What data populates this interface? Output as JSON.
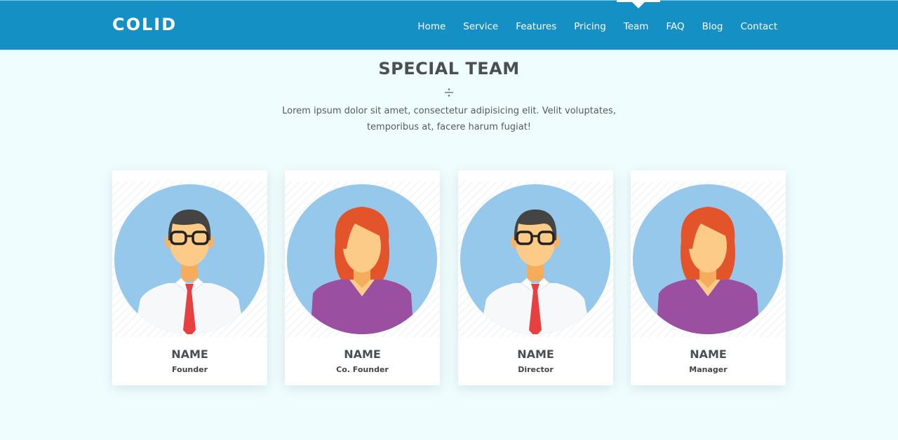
{
  "brand": "COLID",
  "nav": {
    "items": [
      {
        "label": "Home"
      },
      {
        "label": "Service"
      },
      {
        "label": "Features"
      },
      {
        "label": "Pricing"
      },
      {
        "label": "Team"
      },
      {
        "label": "FAQ"
      },
      {
        "label": "Blog"
      },
      {
        "label": "Contact"
      }
    ],
    "active": "Team"
  },
  "section": {
    "title": "SPECIAL TEAM",
    "description": "Lorem ipsum dolor sit amet, consectetur adipisicing elit. Velit voluptates, temporibus at, facere harum fugiat!"
  },
  "team": [
    {
      "name": "NAME",
      "role": "Founder",
      "avatar": "male-avatar"
    },
    {
      "name": "NAME",
      "role": "Co. Founder",
      "avatar": "female-avatar"
    },
    {
      "name": "NAME",
      "role": "Director",
      "avatar": "male-avatar"
    },
    {
      "name": "NAME",
      "role": "Manager",
      "avatar": "female-avatar"
    }
  ],
  "colors": {
    "navbar": "#1590c5",
    "background": "#f0fdfe",
    "avatar_circle": "#96c8ec",
    "shirt_female": "#9b4fa1",
    "tie": "#e84040",
    "hair_female": "#e4542a",
    "skin": "#fccb88"
  }
}
